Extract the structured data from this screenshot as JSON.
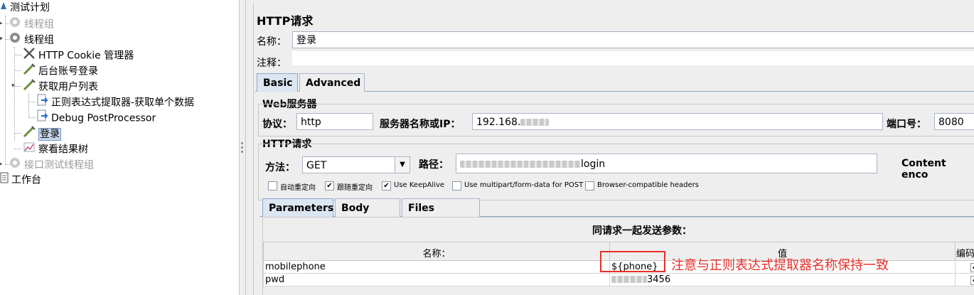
{
  "tree": {
    "items": [
      {
        "label": "测试计划",
        "icon": "test-plan-icon",
        "disabled": false
      },
      {
        "label": "线程组",
        "icon": "gear-icon",
        "disabled": true
      },
      {
        "label": "线程组",
        "icon": "gear-icon",
        "disabled": false
      },
      {
        "label": "HTTP Cookie 管理器",
        "icon": "cookie-manager-icon",
        "disabled": false
      },
      {
        "label": "后台账号登录",
        "icon": "http-sampler-icon",
        "disabled": false
      },
      {
        "label": "获取用户列表",
        "icon": "http-sampler-icon",
        "disabled": false
      },
      {
        "label": "正则表达式提取器-获取单个数据",
        "icon": "post-processor-icon",
        "disabled": false
      },
      {
        "label": "Debug PostProcessor",
        "icon": "post-processor-icon",
        "disabled": false
      },
      {
        "label": "登录",
        "icon": "http-sampler-icon",
        "disabled": false,
        "selected": true
      },
      {
        "label": "察看结果树",
        "icon": "results-tree-icon",
        "disabled": false
      },
      {
        "label": "接口测试线程组",
        "icon": "gear-icon",
        "disabled": true
      },
      {
        "label": "工作台",
        "icon": "workbench-icon",
        "disabled": false
      }
    ]
  },
  "panel": {
    "title": "HTTP请求",
    "name_label": "名称：",
    "name_value": "登录",
    "comment_label": "注释："
  },
  "tabs": {
    "basic": "Basic",
    "advanced": "Advanced"
  },
  "web_server": {
    "group_title": "Web服务器",
    "protocol_label": "协议：",
    "protocol_value": "http",
    "server_label": "服务器名称或IP：",
    "server_value": "192.168.",
    "port_label": "端口号：",
    "port_value": "8080"
  },
  "http_request": {
    "group_title": "HTTP请求",
    "method_label": "方法：",
    "method_value": "GET",
    "path_label": "路径：",
    "path_value": "login",
    "content_encoding_label": "Content enco"
  },
  "checkboxes": [
    {
      "label": "自动重定向",
      "checked": false
    },
    {
      "label": "跟随重定向",
      "checked": true
    },
    {
      "label": "Use KeepAlive",
      "checked": true
    },
    {
      "label": "Use multipart/form-data for POST",
      "checked": false
    },
    {
      "label": "Browser-compatible headers",
      "checked": false
    }
  ],
  "subtabs": {
    "parameters": "Parameters",
    "body_data": "Body Data",
    "files_upload": "Files Upload"
  },
  "params_table": {
    "caption": "同请求一起发送参数：",
    "headers": {
      "name": "名称：",
      "value": "值",
      "encode": "编码"
    },
    "rows": [
      {
        "name": "mobilephone",
        "value": "${phone}",
        "encode": true
      },
      {
        "name": "pwd",
        "value": "3456",
        "encode": true
      }
    ]
  },
  "annotation": {
    "text": "注意与正则表达式提取器名称保持一致",
    "color": "#e8302a"
  },
  "colors": {
    "accent": "#dce6f3",
    "highlight_box": "#e8302a"
  }
}
